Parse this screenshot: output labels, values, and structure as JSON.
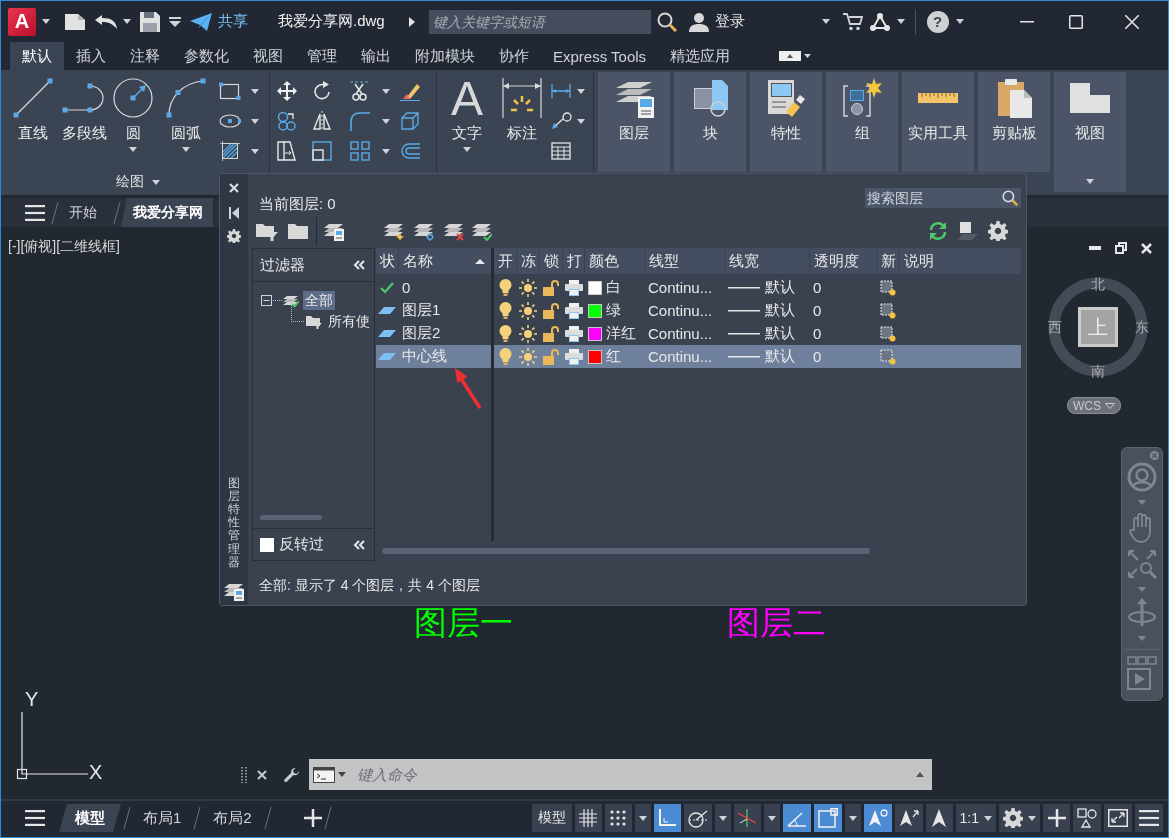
{
  "title_bar": {
    "logo": "A",
    "share": "共享",
    "file_name": "我爱分享网.dwg",
    "search": {
      "placeholder": "键入关键字或短语"
    },
    "sign_in": "登录",
    "help": "?"
  },
  "ribbon_tabs": [
    {
      "label": "默认",
      "selected": true
    },
    {
      "label": "插入",
      "selected": false
    },
    {
      "label": "注释",
      "selected": false
    },
    {
      "label": "参数化",
      "selected": false
    },
    {
      "label": "视图",
      "selected": false
    },
    {
      "label": "管理",
      "selected": false
    },
    {
      "label": "输出",
      "selected": false
    },
    {
      "label": "附加模块",
      "selected": false
    },
    {
      "label": "协作",
      "selected": false
    },
    {
      "label": "Express Tools",
      "selected": false
    },
    {
      "label": "精选应用",
      "selected": false
    }
  ],
  "ribbon": {
    "draw_tools": [
      {
        "kind": "line",
        "label": "直线",
        "menu": false
      },
      {
        "kind": "polyline",
        "label": "多段线",
        "menu": false
      },
      {
        "kind": "circle",
        "label": "圆",
        "menu": true
      },
      {
        "kind": "arc",
        "label": "圆弧",
        "menu": true
      }
    ],
    "draw_title": "绘图",
    "text_tool": {
      "glyph": "A",
      "label": "文字",
      "menu": true
    },
    "dimension_tool": {
      "label": "标注",
      "menu": false
    },
    "panel_buttons": [
      {
        "kind": "layers",
        "label": "图层",
        "menu": false
      },
      {
        "kind": "block",
        "label": "块",
        "menu": false
      },
      {
        "kind": "properties",
        "label": "特性",
        "menu": false
      },
      {
        "kind": "group",
        "label": "组",
        "menu": false
      },
      {
        "kind": "utilities",
        "label": "实用工具",
        "menu": false
      },
      {
        "kind": "clipboard",
        "label": "剪贴板",
        "menu": false
      },
      {
        "kind": "view",
        "label": "视图",
        "menu": true
      }
    ]
  },
  "file_tabs": [
    {
      "label": "开始",
      "selected": false
    },
    {
      "label": "我爱分享网",
      "selected": true
    }
  ],
  "viewport": {
    "label": "[-][俯视][二维线框]"
  },
  "view_cube": {
    "face": "上",
    "north": "北",
    "south": "南",
    "east": "东",
    "west": "西",
    "ucs_menu": "WCS"
  },
  "ucs_icon": {
    "x_label": "X",
    "y_label": "Y"
  },
  "drawing_texts": [
    {
      "text": "图层一",
      "color": "#00ff00"
    },
    {
      "text": "图层二",
      "color": "#ff00ff"
    }
  ],
  "layer_manager": {
    "title": "图层特性管理器",
    "current_layer": "当前图层: 0",
    "search": {
      "placeholder": "搜索图层"
    },
    "filters": {
      "header": "过滤器",
      "tree": [
        {
          "label": "全部",
          "selected": true,
          "expanded": true,
          "children": [
            {
              "label": "所有使",
              "selected": false
            }
          ]
        }
      ],
      "invert": {
        "label": "反转过",
        "checked": false
      }
    },
    "columns": [
      "状",
      "名称",
      "开",
      "冻",
      "锁",
      "打",
      "颜色",
      "线型",
      "线宽",
      "透明度",
      "新",
      "说明"
    ],
    "layers": [
      {
        "current": true,
        "name": "0",
        "on": true,
        "frozen": false,
        "locked": false,
        "plot": true,
        "color": "#ffffff",
        "color_name": "白",
        "linetype": "Continu...",
        "lineweight": "默认",
        "transparency": "0",
        "selected": false
      },
      {
        "current": false,
        "name": "图层1",
        "on": true,
        "frozen": false,
        "locked": false,
        "plot": true,
        "color": "#00ff00",
        "color_name": "绿",
        "linetype": "Continu...",
        "lineweight": "默认",
        "transparency": "0",
        "selected": false
      },
      {
        "current": false,
        "name": "图层2",
        "on": true,
        "frozen": false,
        "locked": false,
        "plot": true,
        "color": "#ff00ff",
        "color_name": "洋红",
        "linetype": "Continu...",
        "lineweight": "默认",
        "transparency": "0",
        "selected": false
      },
      {
        "current": false,
        "name": "中心线",
        "on": true,
        "frozen": false,
        "locked": false,
        "plot": true,
        "color": "#ff0000",
        "color_name": "红",
        "linetype": "Continu...",
        "lineweight": "默认",
        "transparency": "0",
        "selected": true
      }
    ],
    "status": "全部: 显示了 4 个图层，共 4 个图层"
  },
  "command_line": {
    "placeholder": "键入命令"
  },
  "status_bar": {
    "layout_tabs": [
      {
        "label": "模型",
        "selected": true
      },
      {
        "label": "布局1",
        "selected": false
      },
      {
        "label": "布局2",
        "selected": false
      }
    ],
    "space": "模型",
    "toggles": [
      {
        "kind": "grid",
        "on": false,
        "menu": false
      },
      {
        "kind": "snap",
        "on": false,
        "menu": true
      },
      {
        "kind": "ortho",
        "on": true,
        "menu": false
      },
      {
        "kind": "polar",
        "on": false,
        "menu": true
      },
      {
        "kind": "isodraft",
        "on": false,
        "menu": true
      },
      {
        "kind": "tracking",
        "on": true,
        "menu": false
      },
      {
        "kind": "osnap",
        "on": true,
        "menu": true
      },
      {
        "kind": "annovis",
        "on": true,
        "menu": false
      },
      {
        "kind": "autoscale",
        "on": false,
        "menu": false
      },
      {
        "kind": "annoscale",
        "on": false,
        "menu": false
      }
    ],
    "scale": "1:1"
  }
}
